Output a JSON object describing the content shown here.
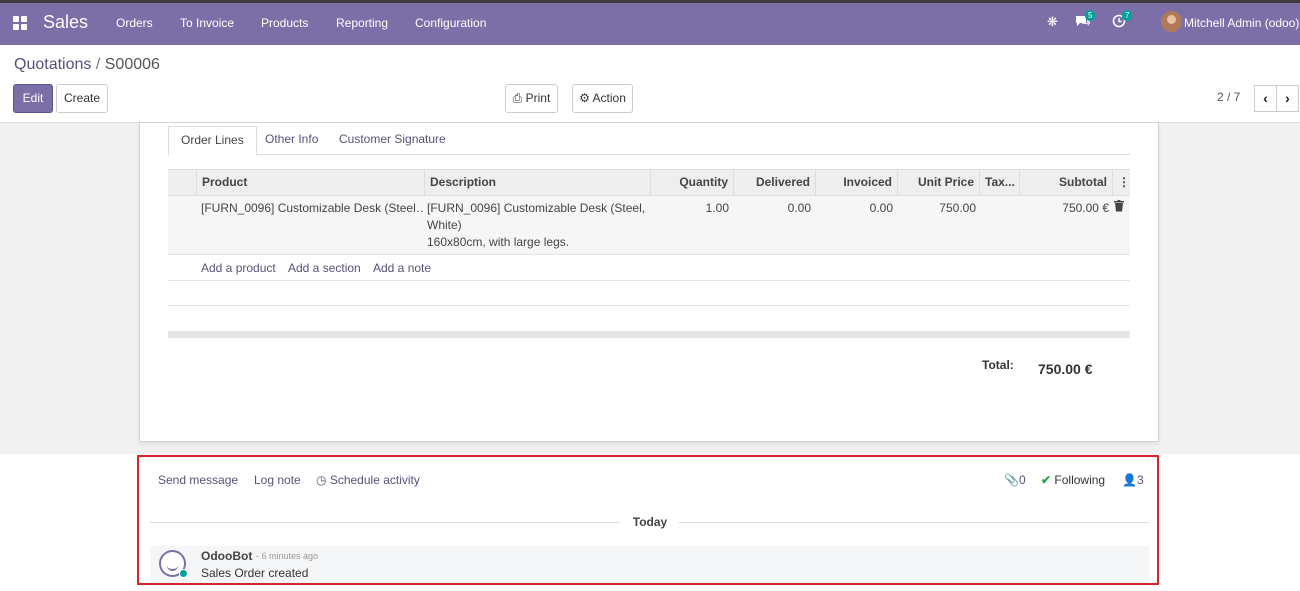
{
  "navbar": {
    "app_name": "Sales",
    "menu": [
      "Orders",
      "To Invoice",
      "Products",
      "Reporting",
      "Configuration"
    ],
    "messages_count": "5",
    "activities_count": "7",
    "user_name": "Mitchell Admin (odoo)"
  },
  "breadcrumb": {
    "parent": "Quotations",
    "separator": "/",
    "current": "S00006"
  },
  "buttons": {
    "edit": "Edit",
    "create": "Create",
    "print": "Print",
    "action": "Action"
  },
  "pager": {
    "value": "2 / 7"
  },
  "tabs": [
    "Order Lines",
    "Other Info",
    "Customer Signature"
  ],
  "order_lines": {
    "columns": [
      "Product",
      "Description",
      "Quantity",
      "Delivered",
      "Invoiced",
      "Unit Price",
      "Tax...",
      "Subtotal"
    ],
    "rows": [
      {
        "product": "[FURN_0096] Customizable Desk (Steel…",
        "description_line1": "[FURN_0096] Customizable Desk (Steel,",
        "description_line2": "White)",
        "description_line3": "160x80cm, with large legs.",
        "quantity": "1.00",
        "delivered": "0.00",
        "invoiced": "0.00",
        "unit_price": "750.00",
        "subtotal": "750.00 €"
      }
    ],
    "add_product": "Add a product",
    "add_section": "Add a section",
    "add_note": "Add a note"
  },
  "totals": {
    "label": "Total:",
    "value": "750.00 €"
  },
  "chatter": {
    "send_message": "Send message",
    "log_note": "Log note",
    "schedule_activity": "Schedule activity",
    "attachments": "0",
    "following": "Following",
    "followers": "3",
    "date_separator": "Today",
    "message": {
      "author": "OdooBot",
      "time": "- 6 minutes ago",
      "body": "Sales Order created"
    }
  },
  "colors": {
    "brand": "#7c6fa8",
    "highlight_border": "#d9232d",
    "accent": "#00a09d"
  }
}
